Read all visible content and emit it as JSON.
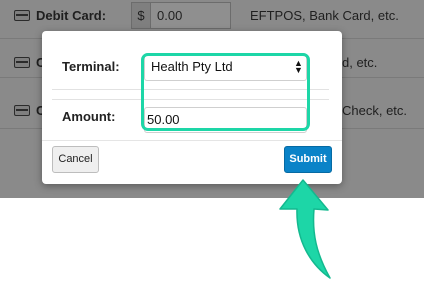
{
  "background_form": {
    "rows": [
      {
        "label": "Debit Card:",
        "currency_symbol": "$",
        "amount_value": "0.00",
        "hint": "EFTPOS, Bank Card, etc."
      },
      {
        "label": "C",
        "hint": "d, etc."
      },
      {
        "label": "C",
        "hint": "Check, etc."
      }
    ]
  },
  "modal": {
    "terminal_label": "Terminal:",
    "terminal_selected": "Health Pty Ltd",
    "amount_label": "Amount:",
    "amount_value": "50.00",
    "cancel_label": "Cancel",
    "submit_label": "Submit"
  },
  "colors": {
    "highlight": "#1dd6a7",
    "submit_bg": "#0a83c8",
    "arrow": "#1dd6a7"
  },
  "icons": {
    "card": "card-icon",
    "select_arrows": "select-arrows-icon",
    "pointer_arrow": "pointer-arrow-icon"
  }
}
